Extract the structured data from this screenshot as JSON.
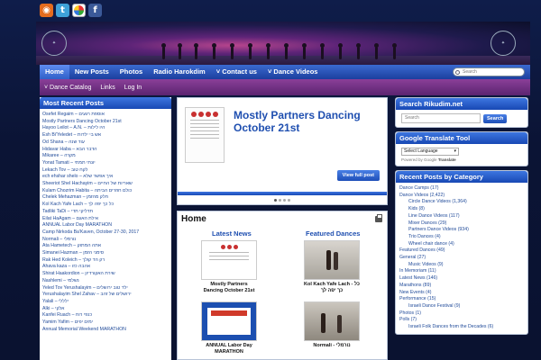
{
  "social": [
    "rss-icon",
    "twitter-icon",
    "picasa-icon",
    "facebook-icon"
  ],
  "nav": {
    "items": [
      "Home",
      "New Posts",
      "Photos",
      "Radio Harokdim",
      "Contact us",
      "Dance Videos"
    ],
    "search_placeholder": "Search"
  },
  "subnav": {
    "items": [
      "Dance Catalog",
      "Links",
      "Log In"
    ]
  },
  "left": {
    "title": "Most Recent Posts",
    "posts": [
      "Osefet Regaim – אוספת רגעים",
      "Mostly Partners Dancing October 21st",
      "Hayoo Leilot – A.N. – היו לילות",
      "Esh Bi'Yeledet – אש בי ילדות",
      "Od Shana – עוד שנה",
      "Hidavar Haba – הדבר הבא",
      "Mikaree – מקרה",
      "Yonat Tamati – יונתי תמתי",
      "Lekach Tov – לקח טוב",
      "ech ehshar shelo – איך אפשר שלא",
      "Sheeriot Shel Hachayim – שאריות של החיים",
      "Kulam Chozrim Habita – כולם חוזרים הביתה",
      "Chelek Mehazman – חלק מהזמן",
      "Kol Kach Yafe Lach – כל כך יפה לך",
      "Tadliki TaDi – תדליקי תדי",
      "Eilat HaAgam – אילת האגם",
      "ANNUAL Labor Day MARATHON",
      "Camp Nirkoda Ba'Kaven, October 27-30, 2017",
      "Normali – נורמלי",
      "Ata Hametech – אתה המתוק",
      "Simanei Hazman – סימני הזמן",
      "Rak Hed Koleich – רק הד קולך",
      "Ahava kaza – אהבה כזו",
      "Shirat Haakordion – שירת האקורדיון",
      "Nashlemi – נשלמי",
      "Yeled Tov Yerushalayim – ילד טוב ירושלים",
      "Yerushalayim Shel Zahav – ירושלים של זהב",
      "Yalali – ילללי",
      "Alki – אלקי",
      "Kanfei Ruach – כנפי רוח",
      "Yamim Yafim – ימים יפים",
      "Annual Memorial Weekend MARATHON"
    ]
  },
  "featured": {
    "title": "Mostly Partners Dancing October 21st",
    "button": "View full post"
  },
  "home": {
    "title": "Home",
    "latest_news": "Latest News",
    "featured_dances": "Featured Dances",
    "cards": [
      "Mostly Partners Dancing October 21st",
      "Kol Kach Yafe Lach - כל כך יפה לך",
      "ANNUAL Labor Day MARATHON",
      "Normali - נורמלי"
    ]
  },
  "right": {
    "search_title": "Search Rikudim.net",
    "search_placeholder": "Search",
    "search_button": "Search",
    "translate_title": "Google Translate Tool",
    "select_language": "Select Language",
    "powered_by": "Powered by",
    "google": "Google",
    "translate": "Translate",
    "cats_title": "Recent Posts by Category",
    "categories": [
      {
        "label": "Dance Camps (17)",
        "sub": false
      },
      {
        "label": "Dance Videos (2,422)",
        "sub": false
      },
      {
        "label": "Circle Dance Videos (1,364)",
        "sub": true
      },
      {
        "label": "Kids (8)",
        "sub": true
      },
      {
        "label": "Line Dance Videos (117)",
        "sub": true
      },
      {
        "label": "Mixer Dances (29)",
        "sub": true
      },
      {
        "label": "Partners Dance Videos (934)",
        "sub": true
      },
      {
        "label": "Trio Dances (4)",
        "sub": true
      },
      {
        "label": "Wheel chair dance (4)",
        "sub": true
      },
      {
        "label": "Featured Dances (49)",
        "sub": false
      },
      {
        "label": "General (27)",
        "sub": false
      },
      {
        "label": "Music Videos (9)",
        "sub": true
      },
      {
        "label": "In Memoriam (11)",
        "sub": false
      },
      {
        "label": "Latest News (146)",
        "sub": false
      },
      {
        "label": "Marathons (89)",
        "sub": false
      },
      {
        "label": "New Events (4)",
        "sub": false
      },
      {
        "label": "Performance (15)",
        "sub": false
      },
      {
        "label": "Israeli Dance Festival (9)",
        "sub": true
      },
      {
        "label": "Photos (1)",
        "sub": false
      },
      {
        "label": "Polls (7)",
        "sub": false
      },
      {
        "label": "Israeli Folk Dances from the Decades (6)",
        "sub": true
      }
    ]
  }
}
